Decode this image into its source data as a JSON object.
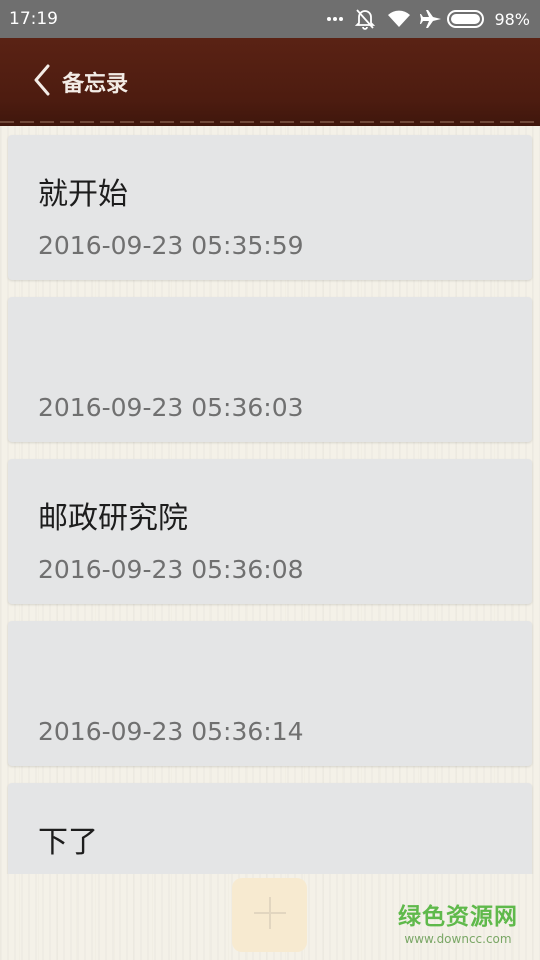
{
  "status_bar": {
    "time": "17:19",
    "battery": "98%",
    "icons": [
      "more-dots-icon",
      "bell-off-icon",
      "wifi-icon",
      "airplane-icon",
      "battery-icon"
    ]
  },
  "header": {
    "title": "备忘录",
    "back_icon": "chevron-left-icon",
    "background_color": "#4d1c10"
  },
  "memos": [
    {
      "title": "就开始",
      "date": "2016-09-23 05:35:59"
    },
    {
      "title": "",
      "date": "2016-09-23 05:36:03"
    },
    {
      "title": "邮政研究院",
      "date": "2016-09-23 05:36:08"
    },
    {
      "title": "",
      "date": "2016-09-23 05:36:14"
    },
    {
      "title": "下了",
      "date": ""
    }
  ],
  "add_button": {
    "icon": "plus-icon",
    "color": "#f7ead0"
  },
  "watermark": {
    "logo": "绿色资源网",
    "url": "www.downcc.com"
  }
}
